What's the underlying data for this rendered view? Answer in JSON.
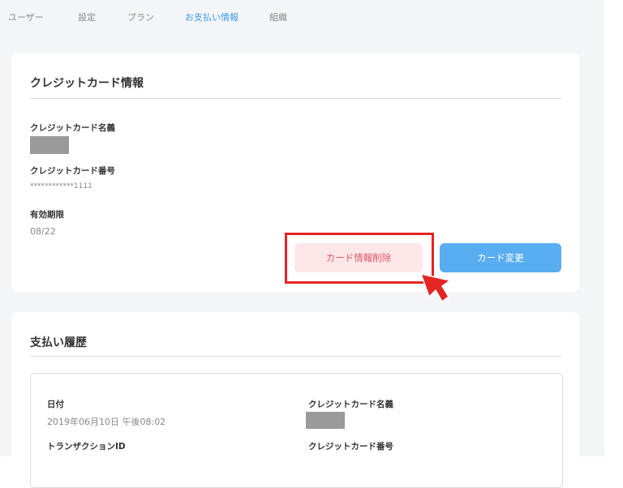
{
  "tabs": [
    {
      "label": "ユーザー",
      "active": false
    },
    {
      "label": "設定",
      "active": false
    },
    {
      "label": "プラン",
      "active": false
    },
    {
      "label": "お支払い情報",
      "active": true
    },
    {
      "label": "組織",
      "active": false
    }
  ],
  "credit_card": {
    "title": "クレジットカード情報",
    "name_label": "クレジットカード名義",
    "number_label": "クレジットカード番号",
    "number_value": "************1111",
    "expiry_label": "有効期限",
    "expiry_value": "08/22",
    "delete_button": "カード情報削除",
    "change_button": "カード変更"
  },
  "payment_history": {
    "title": "支払い履歴",
    "date_label": "日付",
    "date_value": "2019年06月10日 午後08:02",
    "card_name_label": "クレジットカード名義",
    "transaction_label": "トランザクションID",
    "card_number_label": "クレジットカード番号"
  },
  "colors": {
    "accent": "#3a9be8",
    "delete_text": "#e2535e",
    "delete_bg": "#fde7e9",
    "change_bg": "#59adf1",
    "highlight": "#e52424"
  },
  "icons": {
    "pointer": "cursor-arrow-icon"
  }
}
